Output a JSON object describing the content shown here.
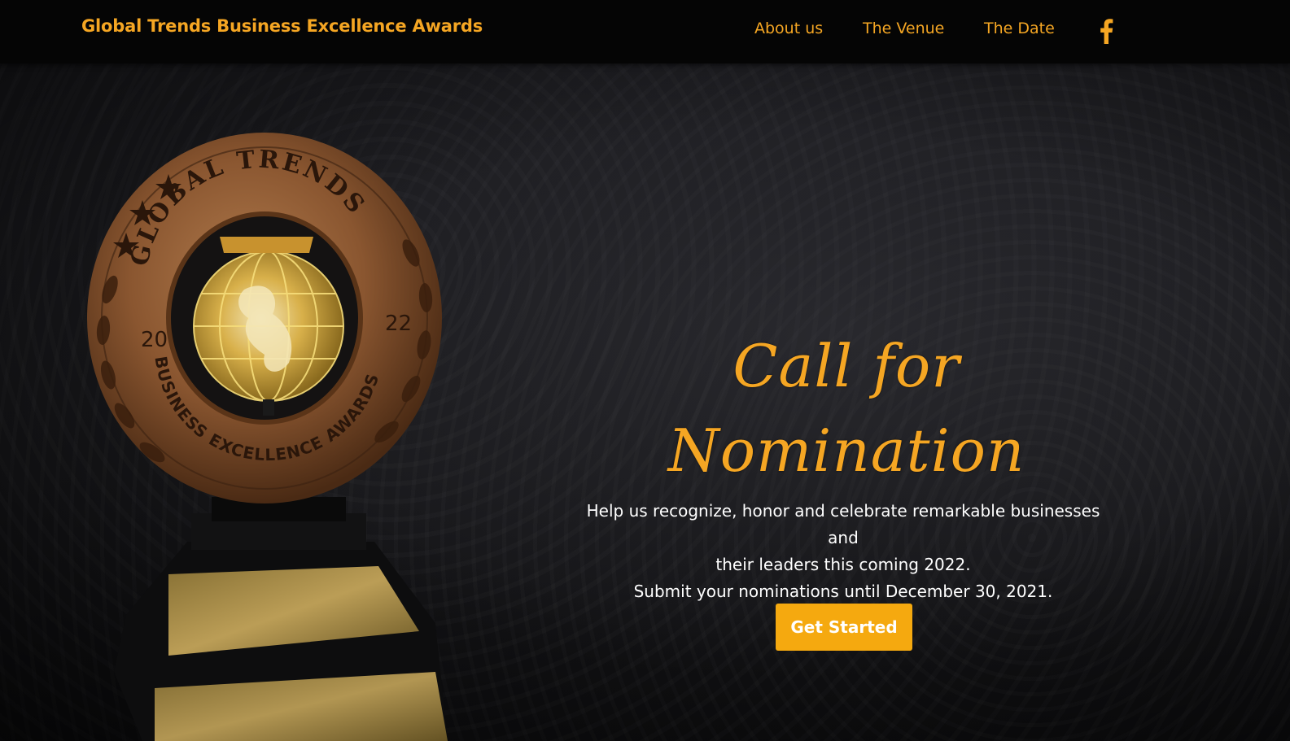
{
  "header": {
    "brand": "Global Trends Business Excellence Awards",
    "nav": [
      {
        "label": "About us"
      },
      {
        "label": "The Venue"
      },
      {
        "label": "The Date"
      }
    ],
    "social_icon": "facebook-icon"
  },
  "hero": {
    "title_line1": "Call for",
    "title_line2": "Nomination",
    "description_line1": "Help us recognize, honor and celebrate remarkable businesses and",
    "description_line2": "their leaders this coming 2022.",
    "description_line3": "Submit your nominations until December 30, 2021.",
    "cta_label": "Get Started",
    "trophy_ring_top": "GLOBAL TRENDS",
    "trophy_ring_bottom": "BUSINESS EXCELLENCE AWARDS",
    "trophy_year_left": "20",
    "trophy_year_right": "22"
  },
  "colors": {
    "accent": "#f5a623",
    "button": "#f5a90f",
    "header_bg": "#050505",
    "hero_bg": "#17171a"
  }
}
